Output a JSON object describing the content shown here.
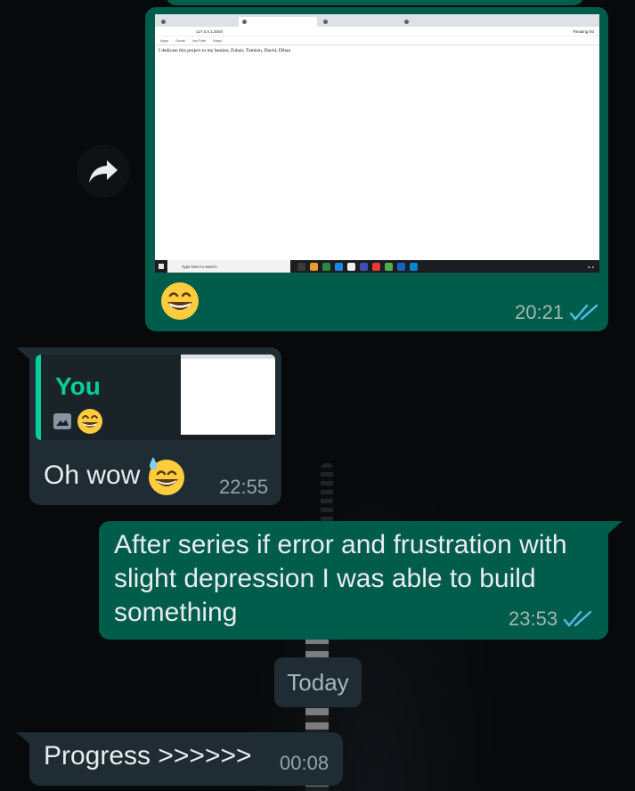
{
  "theme": {
    "outgoing_bubble": "#005c4b",
    "incoming_bubble": "#1f2c33",
    "accent": "#06cf9c",
    "read_tick": "#53bdeb",
    "background": "#07090a"
  },
  "messages": [
    {
      "direction": "outgoing",
      "type": "image",
      "caption_emoji": "grinning-face-with-smiling-eyes",
      "time": "20:21",
      "status": "read",
      "forward_icon": "forward-arrow-icon",
      "screenshot": {
        "url": "127.0.0.1:3000",
        "bookmarks": [
          "Apps",
          "Gmail",
          "YouTube",
          "Maps"
        ],
        "reading_list": "Reading list",
        "page_text": "I dedicate this project to my besties; Zubair, Tomisin, David, Dihan",
        "taskbar_search": "Type here to search"
      }
    },
    {
      "direction": "incoming",
      "type": "reply",
      "quoted_author": "You",
      "quoted_preview_icon": "photo-icon",
      "quoted_preview_emoji": "grinning-face-with-smiling-eyes",
      "text": "Oh wow",
      "emoji": "grinning-face-with-sweat",
      "time": "22:55"
    },
    {
      "direction": "outgoing",
      "type": "text",
      "text": "After series if error and frustration with slight depression I was able to build something",
      "time": "23:53",
      "status": "read"
    },
    {
      "type": "date-divider",
      "label": "Today"
    },
    {
      "direction": "incoming",
      "type": "text",
      "text": "Progress >>>>>>",
      "time": "00:08"
    }
  ]
}
